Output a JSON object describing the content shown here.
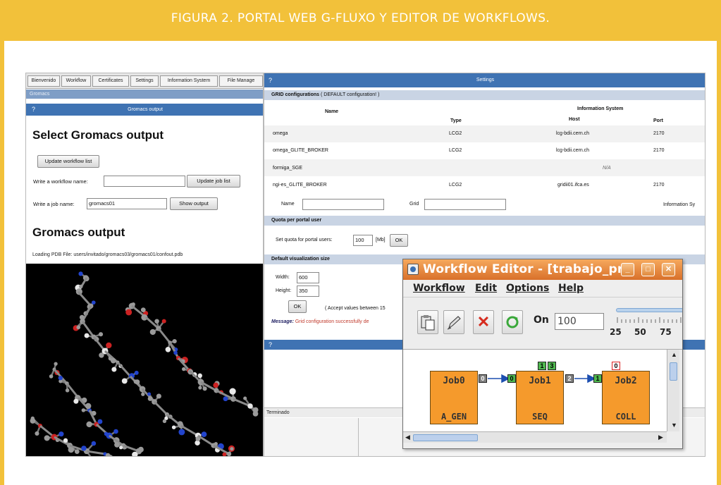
{
  "banner": {
    "title": "FIGURA 2. PORTAL WEB G-FLUXO Y EDITOR DE WORKFLOWS."
  },
  "gromacs_panel": {
    "tabs": [
      "Bienvenido",
      "Workflow",
      "Certificates",
      "Settings",
      "Information System",
      "File Manage"
    ],
    "subheader": "Gromacs",
    "bar_title": "Gromacs output",
    "bar_icon": "?",
    "heading_select": "Select Gromacs output",
    "update_workflow_button": "Update workflow list",
    "workflow_label": "Write a workflow name:",
    "workflow_value": "",
    "update_job_button": "Update job list",
    "job_label": "Write a job name:",
    "job_value": "gromacs01",
    "show_output_button": "Show output",
    "heading_output": "Gromacs output",
    "loading_text": "Loading PDB File: users/invitado/gromacs03/gromacs01/confout.pdb"
  },
  "settings_panel": {
    "bar_title": "Settings",
    "bar_icon": "?",
    "grid_header_bold": "GRID configurations",
    "grid_header_rest": "( DEFAULT configuration! )",
    "col_name": "Name",
    "col_type": "Type",
    "col_info": "Information System",
    "col_host": "Host",
    "col_port": "Port",
    "rows": [
      {
        "name": "omega",
        "type": "LCG2",
        "host": "lcg-bdii.cern.ch",
        "port": "2170"
      },
      {
        "name": "omega_GLITE_BROKER",
        "type": "LCG2",
        "host": "lcg-bdii.cern.ch",
        "port": "2170"
      },
      {
        "name": "formiga_SGE",
        "type": "",
        "host": "N/A",
        "port": ""
      },
      {
        "name": "ngi-es_GLITE_BROKER",
        "type": "LCG2",
        "host": "gridii01.ifca.es",
        "port": "2170"
      }
    ],
    "new_name_label": "Name",
    "new_grid_label": "Grid",
    "new_info_label": "Information Sy",
    "quota_header": "Quota per portal user",
    "quota_label": "Set quota for portal users:",
    "quota_value": "100",
    "quota_unit": "[Mb]",
    "quota_ok": "OK",
    "vis_header": "Default visualization size",
    "width_label": "Width:",
    "width_value": "600",
    "height_label": "Height:",
    "height_value": "350",
    "vis_ok": "OK",
    "accept_text": "( Accept values between 15",
    "message_label": "Message:",
    "message_value": "Grid configuration successfully de",
    "second_bar_icon": "?",
    "status": "Terminado"
  },
  "workflow_editor": {
    "title": "Workflow Editor - [trabajo_pr",
    "menu": [
      "Workflow",
      "Edit",
      "Options",
      "Help"
    ],
    "on_label": "On",
    "on_value": "100",
    "slider_ticks": [
      "25",
      "50",
      "75"
    ],
    "jobs": [
      {
        "name": "Job0",
        "type": "A_GEN"
      },
      {
        "name": "Job1",
        "type": "SEQ"
      },
      {
        "name": "Job2",
        "type": "COLL"
      }
    ],
    "ports": [
      "0",
      "0",
      "1",
      "3",
      "2",
      "1",
      "0"
    ],
    "colors": {
      "title_orange": "#e8853a",
      "job_orange": "#f59a2c",
      "port_green": "#4fb84f",
      "banner_yellow": "#f2c13a"
    },
    "icons": [
      "paste-icon",
      "edit-icon",
      "delete-icon",
      "refresh-icon"
    ]
  }
}
